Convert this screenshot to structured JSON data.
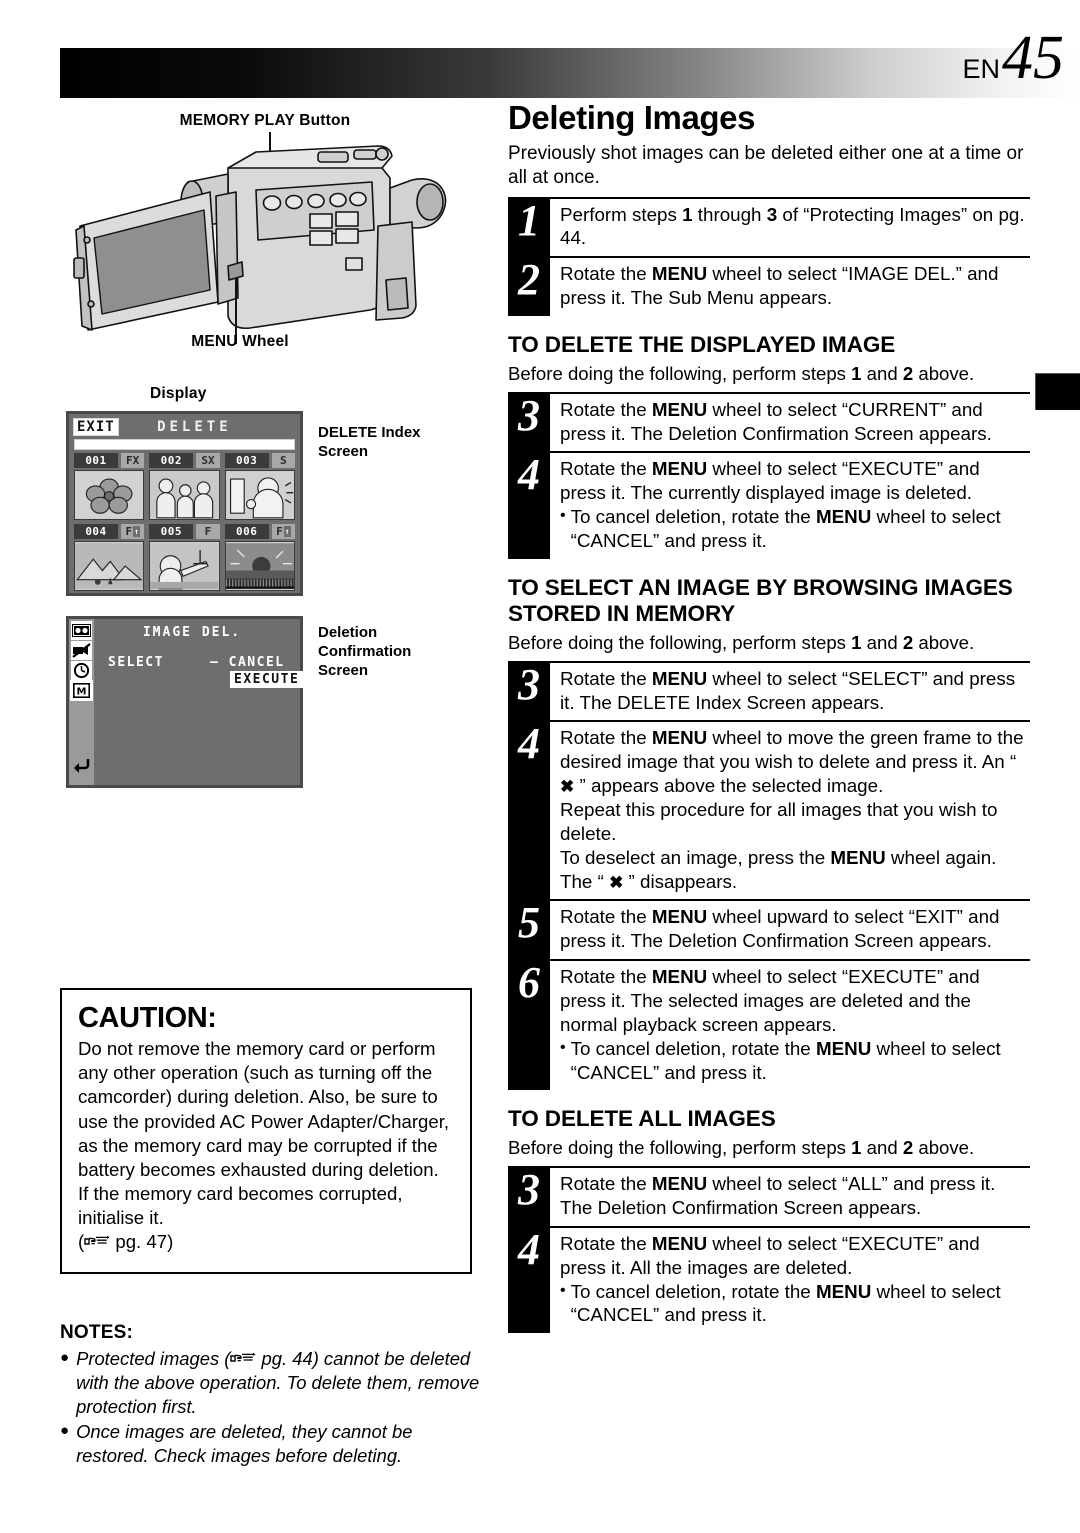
{
  "header": {
    "lang": "EN",
    "page_number": "45"
  },
  "left": {
    "callouts": {
      "memory_play_button": "MEMORY PLAY Button",
      "menu_wheel": "MENU Wheel",
      "display": "Display"
    },
    "screen_notes": {
      "index": "DELETE Index Screen",
      "confirmation": "Deletion Confirmation Screen"
    },
    "index_screen": {
      "exit_label": "EXIT",
      "title": "DELETE",
      "cells": [
        {
          "num": "001",
          "tag": "FX",
          "arrow": ""
        },
        {
          "num": "002",
          "tag": "SX",
          "arrow": ""
        },
        {
          "num": "003",
          "tag": "S",
          "arrow": ""
        },
        {
          "num": "004",
          "tag": "F",
          "arrow": "↑"
        },
        {
          "num": "005",
          "tag": "F",
          "arrow": ""
        },
        {
          "num": "006",
          "tag": "F",
          "arrow": "↑"
        }
      ]
    },
    "confirmation_screen": {
      "title": "IMAGE DEL.",
      "select_label": "SELECT",
      "cancel_label": "– CANCEL",
      "execute_label": "EXECUTE",
      "side_icons": [
        "tape-icon",
        "camera-off-icon",
        "clock-icon",
        "memory-card-icon",
        "return-icon"
      ]
    },
    "caution": {
      "heading": "CAUTION:",
      "body": "Do not remove the memory card or perform any other operation (such as turning off the camcorder) during deletion. Also, be sure to use the provided AC Power Adapter/Charger, as the memory card may be corrupted if the battery becomes exhausted during deletion. If the memory card becomes corrupted, initialise it.",
      "ref_prefix": "(",
      "ref_text": "pg. 47",
      "ref_suffix": ")"
    },
    "notes": {
      "heading": "NOTES:",
      "items": [
        {
          "before_ref": "Protected images (",
          "ref_text": "pg. 44",
          "after_ref": ") cannot be deleted with the above operation. To delete them, remove protection first."
        },
        {
          "before_ref": "Once images are deleted, they cannot be restored. Check images before deleting.",
          "ref_text": "",
          "after_ref": ""
        }
      ]
    }
  },
  "right": {
    "title": "Deleting Images",
    "intro": "Previously shot images can be deleted either one at a time or all at once.",
    "steps_main": [
      {
        "num": "1",
        "html": "Perform steps <b>1</b> through <b>3</b> of “Protecting Images” on pg. 44."
      },
      {
        "num": "2",
        "html": "Rotate the <b>MENU</b> wheel to select “IMAGE DEL.” and press it. The Sub Menu appears."
      }
    ],
    "sections": [
      {
        "heading": "TO DELETE THE DISPLAYED IMAGE",
        "sub": "Before doing the following, perform steps <b>1</b> and <b>2</b> above.",
        "steps": [
          {
            "num": "3",
            "html": "Rotate the <b>MENU</b> wheel to select “CURRENT” and press it. The Deletion Confirmation Screen appears."
          },
          {
            "num": "4",
            "html": "Rotate the <b>MENU</b> wheel to select “EXECUTE” and press it. The currently displayed image is deleted.",
            "bullets": [
              "To cancel deletion, rotate the <b>MENU</b> wheel to select “CANCEL” and press it."
            ]
          }
        ]
      },
      {
        "heading": "TO SELECT AN IMAGE BY BROWSING IMAGES STORED IN MEMORY",
        "sub": "Before doing the following, perform steps <b>1</b> and <b>2</b> above.",
        "steps": [
          {
            "num": "3",
            "html": "Rotate the <b>MENU</b> wheel to select “SELECT” and press it. The DELETE Index Screen appears."
          },
          {
            "num": "4",
            "html": "Rotate the <b>MENU</b> wheel to move the green frame to the desired image that you wish to delete and press it. An “ <span class=\"xg\">✖</span> ” appears above the selected image.<br>Repeat this procedure for all images that you wish to delete.<br>To deselect an image, press the <b>MENU</b> wheel again. The “ <span class=\"xg\">✖</span> ” disappears."
          },
          {
            "num": "5",
            "html": "Rotate the <b>MENU</b> wheel upward to select “EXIT” and press it. The Deletion Confirmation Screen appears."
          },
          {
            "num": "6",
            "html": "Rotate the <b>MENU</b> wheel to select “EXECUTE” and press it. The selected images are deleted and the normal playback screen appears.",
            "bullets": [
              "To cancel deletion, rotate the <b>MENU</b> wheel to select “CANCEL” and press it."
            ]
          }
        ]
      },
      {
        "heading": "TO DELETE ALL IMAGES",
        "sub": "Before doing the following, perform steps <b>1</b> and <b>2</b> above.",
        "steps": [
          {
            "num": "3",
            "html": "Rotate the <b>MENU</b> wheel to select “ALL” and press it. The Deletion Confirmation Screen appears."
          },
          {
            "num": "4",
            "html": "Rotate the <b>MENU</b> wheel to select “EXECUTE” and press it. All the images are deleted.",
            "bullets": [
              "To cancel deletion, rotate the <b>MENU</b> wheel to select “CANCEL” and press it."
            ]
          }
        ]
      }
    ]
  }
}
